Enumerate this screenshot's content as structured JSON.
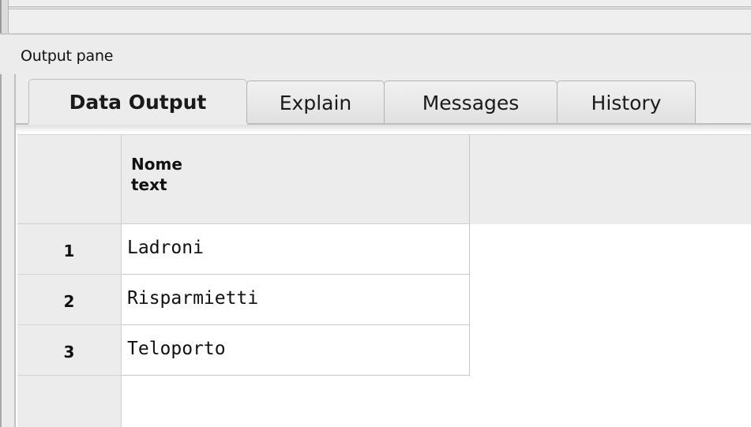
{
  "output_pane": {
    "title": "Output pane",
    "tabs": [
      {
        "label": "Data Output",
        "active": true
      },
      {
        "label": "Explain",
        "active": false
      },
      {
        "label": "Messages",
        "active": false
      },
      {
        "label": "History",
        "active": false
      }
    ]
  },
  "grid": {
    "columns": [
      {
        "name": "Nome",
        "type": "text"
      }
    ],
    "rows": [
      {
        "row_number": "1",
        "values": [
          "Ladroni"
        ]
      },
      {
        "row_number": "2",
        "values": [
          "Risparmietti"
        ]
      },
      {
        "row_number": "3",
        "values": [
          "Teloporto"
        ]
      }
    ]
  }
}
